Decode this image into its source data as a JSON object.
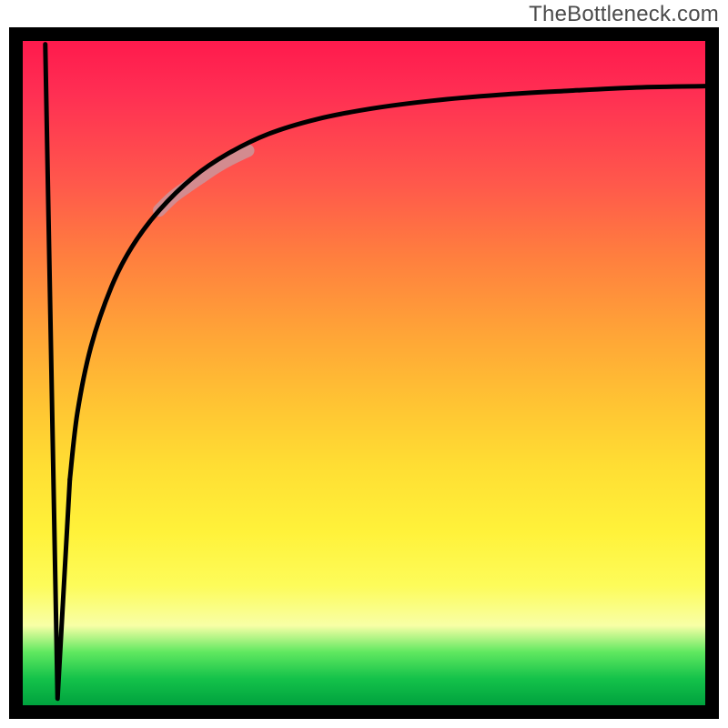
{
  "watermark": "TheBottleneck.com",
  "chart_data": {
    "type": "line",
    "title": "",
    "xlabel": "",
    "ylabel": "",
    "xlim": [
      0,
      100
    ],
    "ylim": [
      0,
      100
    ],
    "grid": false,
    "legend": false,
    "annotations": [],
    "series": [
      {
        "name": "left-spike",
        "color": "#000000",
        "x": [
          3.3,
          5.1,
          6.9
        ],
        "y": [
          99.5,
          1.0,
          34.0
        ]
      },
      {
        "name": "main-curve",
        "color": "#000000",
        "x": [
          6.9,
          8.0,
          10.0,
          13.0,
          16.0,
          20.0,
          25.0,
          30.0,
          36.0,
          43.0,
          51.0,
          60.0,
          70.0,
          80.0,
          90.0,
          100.0
        ],
        "y": [
          34.0,
          44.0,
          54.0,
          63.0,
          69.0,
          74.5,
          79.5,
          83.0,
          86.0,
          88.2,
          89.8,
          91.0,
          91.9,
          92.5,
          93.0,
          93.2
        ]
      },
      {
        "name": "highlight-segment",
        "color": "#d38b8f",
        "x": [
          20.0,
          22.0,
          24.0,
          26.0,
          28.0,
          30.0,
          33.0
        ],
        "y": [
          74.5,
          76.5,
          78.0,
          79.4,
          80.8,
          82.0,
          83.5
        ]
      }
    ],
    "gradient_stops": [
      {
        "pos": 0.0,
        "color": "#ff1a4d"
      },
      {
        "pos": 0.08,
        "color": "#ff2f53"
      },
      {
        "pos": 0.22,
        "color": "#ff5a4b"
      },
      {
        "pos": 0.32,
        "color": "#ff7d3f"
      },
      {
        "pos": 0.44,
        "color": "#ffa437"
      },
      {
        "pos": 0.54,
        "color": "#ffc233"
      },
      {
        "pos": 0.64,
        "color": "#ffde33"
      },
      {
        "pos": 0.74,
        "color": "#fff23a"
      },
      {
        "pos": 0.82,
        "color": "#fdfc5a"
      },
      {
        "pos": 0.88,
        "color": "#f8ffa6"
      },
      {
        "pos": 0.92,
        "color": "#60e860"
      },
      {
        "pos": 0.96,
        "color": "#14c24a"
      },
      {
        "pos": 1.0,
        "color": "#00a23e"
      }
    ]
  }
}
